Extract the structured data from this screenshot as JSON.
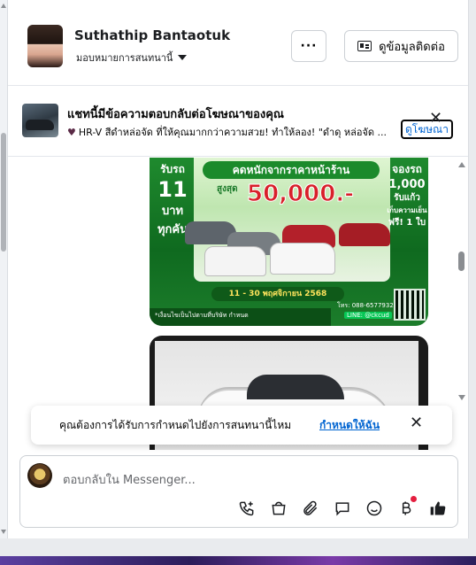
{
  "header": {
    "name": "Suthathip Bantaotuk",
    "status": "มอบหมายการสนทนานี้",
    "more_label": "···",
    "contact_label": "ดูข้อมูลติดต่อ"
  },
  "banner": {
    "title": "แชทนี้มีข้อความตอบกลับต่อโฆษณาของคุณ",
    "text": "HR-V สีดำหล่อจัด ที่ให้คุณมากกว่าความสวย! ทำให้ลอง! \"ดำดุ หล่อจัด ...",
    "view_ad_label": "ดูโฆษณา",
    "close_label": "✕"
  },
  "ad_image": {
    "left_top": "รับรถ",
    "left_big": "11",
    "left_mid": "บาท",
    "left_bottom": "ทุกคัน",
    "headline": "คดหนักจากราคาหน้าร้าน",
    "max_label": "สูงสุด",
    "amount": "50,000.-",
    "right_top": "จองรถ",
    "right_big": "1,000",
    "right_mid": "รับแก้ว",
    "right_small": "เก็บความเย็น",
    "right_free": "ฟรี! 1 ใบ",
    "dates": "11 - 30 พฤศจิกายน 2568",
    "phone": "โทร: 088-6577932",
    "line": "LINE: @ckcud",
    "footer": "*เงื่อนไขเป็นไปตามที่บริษัท กำหนด"
  },
  "toast": {
    "text": "คุณต้องการได้รับการกำหนดไปยังการสนทนานี้ไหม",
    "link": "กำหนดให้ฉัน",
    "close_label": "✕"
  },
  "composer": {
    "placeholder": "ตอบกลับใน Messenger..."
  },
  "tools": [
    "phone-plus-icon",
    "shopping-bag-icon",
    "paperclip-icon",
    "chat-bubble-icon",
    "smiley-icon",
    "baht-icon",
    "thumbs-up-icon"
  ],
  "colors": {
    "link": "#0064d1",
    "ad_green": "#1b8a2b",
    "ad_red": "#d8202a",
    "notification_dot": "#e41e3f"
  }
}
